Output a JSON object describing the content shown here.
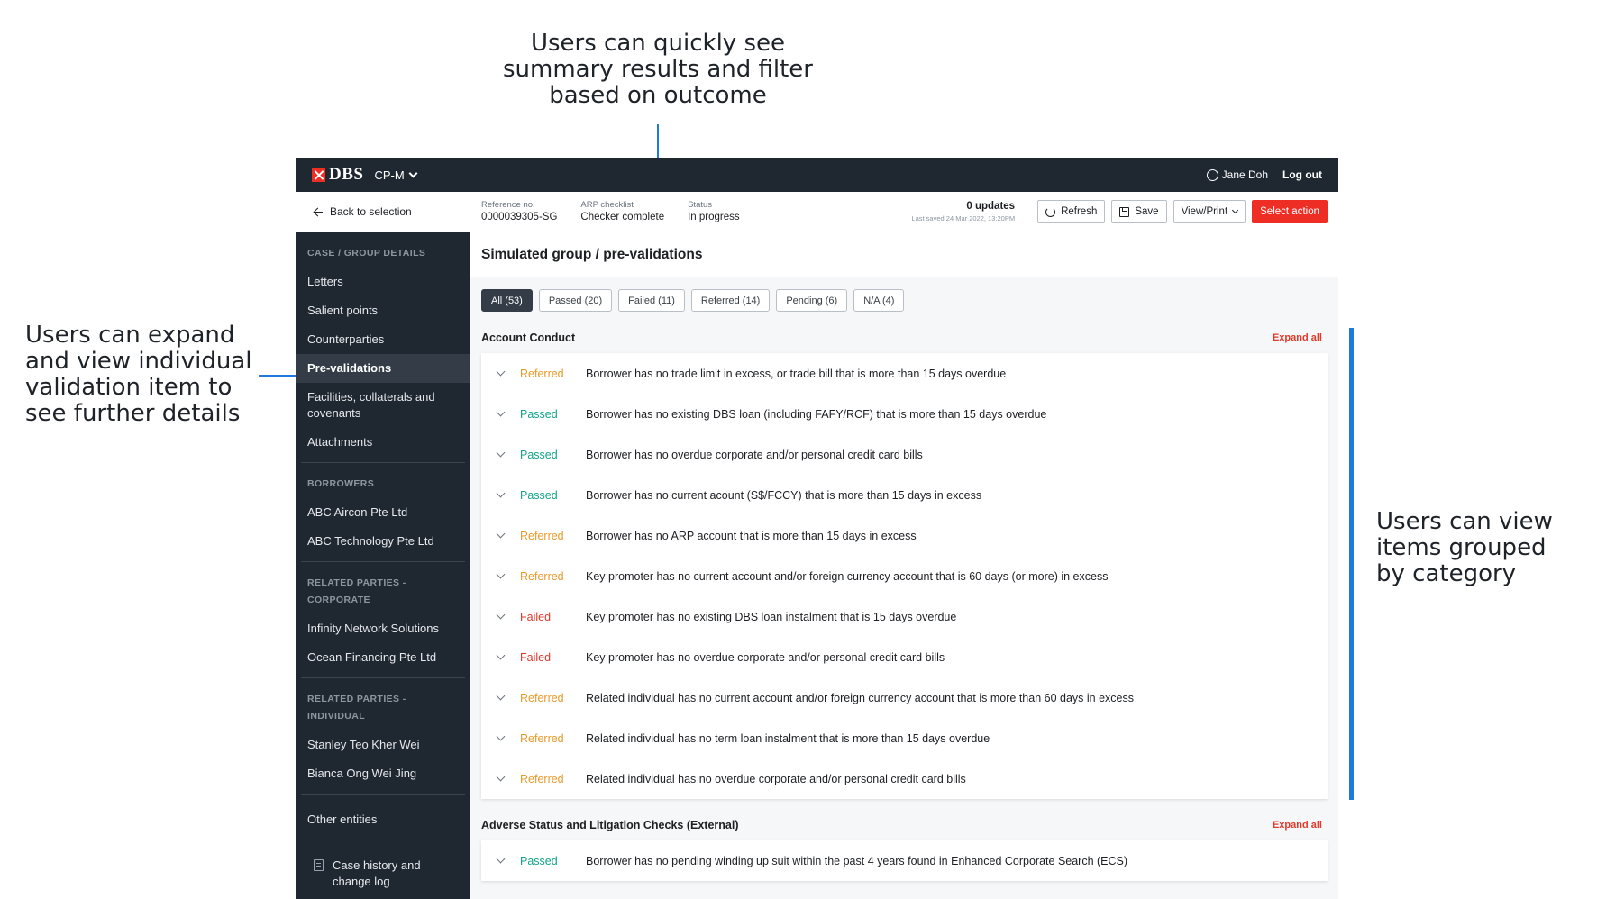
{
  "annotations": {
    "top": "Users can quickly see summary results and filter based on outcome",
    "left": "Users can expand and view individual validation item to see further details",
    "right": "Users can view items grouped by category"
  },
  "topbar": {
    "brand": "DBS",
    "app_switch": "CP-M",
    "user": "Jane Doh",
    "logout": "Log out"
  },
  "sidebar": {
    "back_label": "Back to selection",
    "sections": [
      {
        "heading": "CASE / GROUP DETAILS",
        "items": [
          "Letters",
          "Salient points",
          "Counterparties",
          "Pre-validations",
          "Facilities, collaterals and covenants",
          "Attachments"
        ]
      },
      {
        "heading": "BORROWERS",
        "items": [
          "ABC Aircon Pte Ltd",
          "ABC Technology Pte Ltd"
        ]
      },
      {
        "heading": "RELATED PARTIES - CORPORATE",
        "items": [
          "Infinity Network Solutions",
          "Ocean Financing Pte Ltd"
        ]
      },
      {
        "heading": "RELATED PARTIES - INDIVIDUAL",
        "items": [
          "Stanley Teo Kher Wei",
          "Bianca Ong Wei Jing"
        ]
      },
      {
        "heading": "",
        "items": [
          "Other entities"
        ]
      },
      {
        "heading": "",
        "items": [
          "Case history and change log"
        ]
      }
    ],
    "active_item": "Pre-validations"
  },
  "header": {
    "reference_label": "Reference no.",
    "reference_value": "0000039305-SG",
    "checklist_label": "ARP checklist",
    "checklist_value": "Checker complete",
    "status_label": "Status",
    "status_value": "In progress",
    "updates": "0 updates",
    "last_saved": "Last saved 24 Mar 2022, 13:20PM",
    "refresh": "Refresh",
    "save": "Save",
    "view_print": "View/Print",
    "select_action": "Select action"
  },
  "page_title": "Simulated group / pre-validations",
  "filters": [
    {
      "label": "All (53)",
      "active": true
    },
    {
      "label": "Passed (20)",
      "active": false
    },
    {
      "label": "Failed (11)",
      "active": false
    },
    {
      "label": "Referred (14)",
      "active": false
    },
    {
      "label": "Pending (6)",
      "active": false
    },
    {
      "label": "N/A (4)",
      "active": false
    }
  ],
  "groups": [
    {
      "title": "Account Conduct",
      "expand_all": "Expand all",
      "items": [
        {
          "status": "Referred",
          "text": "Borrower has no trade limit in excess, or trade bill that is more than 15 days overdue"
        },
        {
          "status": "Passed",
          "text": "Borrower has no existing DBS loan (including FAFY/RCF) that is more than 15 days overdue"
        },
        {
          "status": "Passed",
          "text": "Borrower has no overdue corporate and/or personal credit card bills"
        },
        {
          "status": "Passed",
          "text": "Borrower has no current acount (S$/FCCY) that is more than 15 days in excess"
        },
        {
          "status": "Referred",
          "text": "Borrower has no ARP account that is more than 15 days in excess"
        },
        {
          "status": "Referred",
          "text": "Key promoter has no current account and/or foreign currency account that is 60 days (or more) in excess"
        },
        {
          "status": "Failed",
          "text": "Key promoter has no existing DBS loan instalment that is 15 days overdue"
        },
        {
          "status": "Failed",
          "text": "Key promoter has no overdue corporate and/or personal credit card bills"
        },
        {
          "status": "Referred",
          "text": "Related individual has no current account and/or foreign currency account that is more than 60 days in excess"
        },
        {
          "status": "Referred",
          "text": "Related individual has no term loan instalment that is more than 15 days overdue"
        },
        {
          "status": "Referred",
          "text": "Related individual has no overdue corporate and/or personal credit card bills"
        }
      ]
    },
    {
      "title": "Adverse Status and Litigation Checks (External)",
      "expand_all": "Expand all",
      "items": [
        {
          "status": "Passed",
          "text": "Borrower has no pending winding up suit within the past 4 years found in Enhanced Corporate Search (ECS)"
        }
      ]
    }
  ],
  "colors": {
    "passed": "#12a58a",
    "referred": "#e79b2d",
    "failed": "#e0392b",
    "annotation_blue": "#1f7ae0",
    "brand_red": "#ee2e24",
    "nav_dark": "#1f2731"
  }
}
